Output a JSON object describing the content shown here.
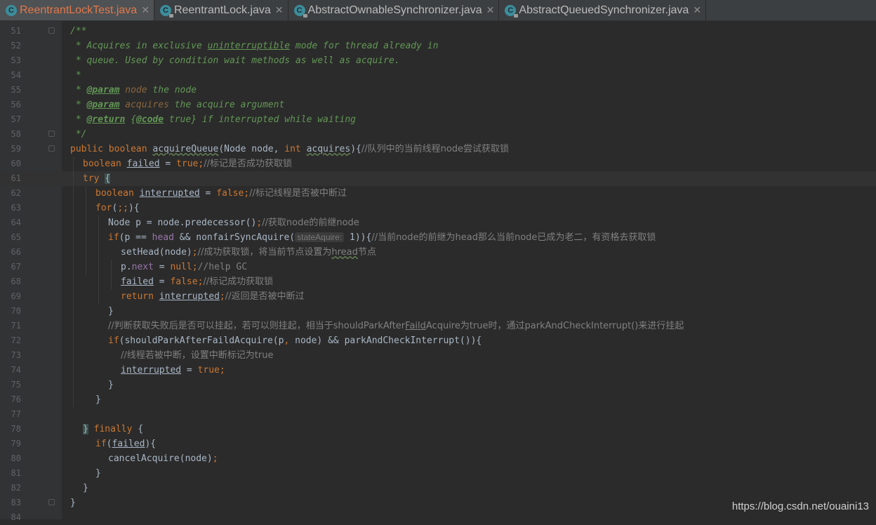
{
  "tabs": [
    {
      "label": "ReentrantLockTest.java",
      "active": true,
      "locked": false
    },
    {
      "label": "ReentrantLock.java",
      "active": false,
      "locked": true
    },
    {
      "label": "AbstractOwnableSynchronizer.java",
      "active": false,
      "locked": true
    },
    {
      "label": "AbstractQueuedSynchronizer.java",
      "active": false,
      "locked": true
    }
  ],
  "lines": [
    {
      "n": "51",
      "fold": true,
      "ind": 0,
      "segs": [
        [
          "cm",
          "/**"
        ]
      ]
    },
    {
      "n": "52",
      "ind": 0,
      "segs": [
        [
          "cm",
          " * Acquires in exclusive "
        ],
        [
          "cm ul",
          "uninterruptible"
        ],
        [
          "cm",
          " mode for thread already in"
        ]
      ]
    },
    {
      "n": "53",
      "ind": 0,
      "segs": [
        [
          "cm",
          " * queue. Used by condition wait methods as well as acquire."
        ]
      ]
    },
    {
      "n": "54",
      "ind": 0,
      "segs": [
        [
          "cm",
          " *"
        ]
      ]
    },
    {
      "n": "55",
      "ind": 0,
      "segs": [
        [
          "cm",
          " * "
        ],
        [
          "tag",
          "@param"
        ],
        [
          "tagv",
          " node"
        ],
        [
          "cm",
          " the node"
        ]
      ]
    },
    {
      "n": "56",
      "ind": 0,
      "segs": [
        [
          "cm",
          " * "
        ],
        [
          "tag",
          "@param"
        ],
        [
          "tagv",
          " acquires"
        ],
        [
          "cm",
          " the acquire argument"
        ]
      ]
    },
    {
      "n": "57",
      "ind": 0,
      "segs": [
        [
          "cm",
          " * "
        ],
        [
          "tag",
          "@return"
        ],
        [
          "cm",
          " {"
        ],
        [
          "tag",
          "@code"
        ],
        [
          "cm",
          " true} if interrupted while waiting"
        ]
      ]
    },
    {
      "n": "58",
      "fold": true,
      "ind": 0,
      "segs": [
        [
          "cm",
          " */"
        ]
      ]
    },
    {
      "n": "59",
      "fold": true,
      "ind": 0,
      "segs": [
        [
          "kw",
          "public boolean "
        ],
        [
          "fn ulw",
          "acquireQueue"
        ],
        [
          "",
          "(Node node, "
        ],
        [
          "kw",
          "int "
        ],
        [
          "ulw",
          "acquires"
        ],
        [
          "",
          "){"
        ],
        [
          "lc cjk",
          "//队列中的当前线程node尝试获取锁"
        ]
      ]
    },
    {
      "n": "60",
      "ind": 1,
      "segs": [
        [
          "kw",
          "boolean "
        ],
        [
          "ul",
          "failed"
        ],
        [
          "",
          " = "
        ],
        [
          "kw",
          "true;"
        ],
        [
          "lc cjk",
          "//标记是否成功获取锁"
        ]
      ]
    },
    {
      "n": "61",
      "ind": 1,
      "current": true,
      "segs": [
        [
          "kw",
          "try "
        ],
        [
          "caret",
          "{"
        ]
      ]
    },
    {
      "n": "62",
      "ind": 2,
      "segs": [
        [
          "kw",
          "boolean "
        ],
        [
          "ul",
          "interrupted"
        ],
        [
          "",
          " = "
        ],
        [
          "kw",
          "false;"
        ],
        [
          "lc cjk",
          "//标记线程是否被中断过"
        ]
      ]
    },
    {
      "n": "63",
      "ind": 2,
      "segs": [
        [
          "kw",
          "for"
        ],
        [
          "",
          "("
        ],
        [
          "kw",
          ";;"
        ],
        [
          "",
          ")"
        ],
        [
          "",
          "{"
        ]
      ]
    },
    {
      "n": "64",
      "ind": 3,
      "segs": [
        [
          "",
          "Node p = node.predecessor()"
        ],
        [
          "kw",
          ";"
        ],
        [
          "lc cjk",
          "//获取node的前继node"
        ]
      ]
    },
    {
      "n": "65",
      "ind": 3,
      "segs": [
        [
          "kw",
          "if"
        ],
        [
          "",
          "(p == "
        ],
        [
          "fld",
          "head"
        ],
        [
          "",
          " && nonfairSyncAquire("
        ],
        [
          "hint",
          "stateAquire:"
        ],
        [
          "",
          " 1)){"
        ],
        [
          "lc cjk",
          "//当前node的前继为head那么当前node已成为老二，有资格去获取锁"
        ]
      ]
    },
    {
      "n": "66",
      "ind": 4,
      "segs": [
        [
          "",
          "setHead(node)"
        ],
        [
          "kw",
          ";"
        ],
        [
          "lc cjk",
          "//成功获取锁，将当前节点设置为"
        ],
        [
          "lc cjk ulw",
          "hread"
        ],
        [
          "lc cjk",
          "节点"
        ]
      ]
    },
    {
      "n": "67",
      "ind": 4,
      "segs": [
        [
          "",
          "p."
        ],
        [
          "fld",
          "next"
        ],
        [
          "",
          " = "
        ],
        [
          "kw",
          "null;"
        ],
        [
          "lc",
          "//help GC"
        ]
      ]
    },
    {
      "n": "68",
      "ind": 4,
      "segs": [
        [
          "ul",
          "failed"
        ],
        [
          "",
          " = "
        ],
        [
          "kw",
          "false;"
        ],
        [
          "lc cjk",
          "//标记成功获取锁"
        ]
      ]
    },
    {
      "n": "69",
      "ind": 4,
      "segs": [
        [
          "kw",
          "return "
        ],
        [
          "ul",
          "interrupted"
        ],
        [
          "kw",
          ";"
        ],
        [
          "lc cjk",
          "//返回是否被中断过"
        ]
      ]
    },
    {
      "n": "70",
      "ind": 3,
      "segs": [
        [
          "",
          "}"
        ]
      ]
    },
    {
      "n": "71",
      "ind": 3,
      "segs": [
        [
          "lc cjk",
          "//判断获取失败后是否可以挂起，若可以则挂起，相当于shouldParkAfter"
        ],
        [
          "lc cjk ul",
          "Faild"
        ],
        [
          "lc cjk",
          "Acquire为true时，通过parkAndCheckInterrupt()来进行挂起"
        ]
      ]
    },
    {
      "n": "72",
      "ind": 3,
      "segs": [
        [
          "kw",
          "if"
        ],
        [
          "",
          "(shouldParkAfterFaildAcquire(p"
        ],
        [
          "kw",
          ", "
        ],
        [
          "",
          "node) && parkAndCheckInterrupt()){"
        ]
      ]
    },
    {
      "n": "73",
      "ind": 4,
      "segs": [
        [
          "lc cjk",
          "//线程若被中断，设置中断标记为true"
        ]
      ]
    },
    {
      "n": "74",
      "ind": 4,
      "segs": [
        [
          "ul",
          "interrupted"
        ],
        [
          "",
          " = "
        ],
        [
          "kw",
          "true;"
        ]
      ]
    },
    {
      "n": "75",
      "ind": 3,
      "segs": [
        [
          "",
          "}"
        ]
      ]
    },
    {
      "n": "76",
      "ind": 2,
      "segs": [
        [
          "",
          "}"
        ]
      ]
    },
    {
      "n": "77",
      "ind": 0,
      "segs": []
    },
    {
      "n": "78",
      "ind": 1,
      "segs": [
        [
          "caret",
          "}"
        ],
        [
          "kw",
          " finally "
        ],
        [
          "",
          "{"
        ]
      ]
    },
    {
      "n": "79",
      "ind": 2,
      "segs": [
        [
          "kw",
          "if"
        ],
        [
          "",
          "("
        ],
        [
          "ul",
          "failed"
        ],
        [
          "",
          ")"
        ],
        [
          "",
          "{"
        ]
      ]
    },
    {
      "n": "80",
      "ind": 3,
      "segs": [
        [
          "",
          "cancelAcquire(node)"
        ],
        [
          "kw",
          ";"
        ]
      ]
    },
    {
      "n": "81",
      "ind": 2,
      "segs": [
        [
          "",
          "}"
        ]
      ]
    },
    {
      "n": "82",
      "ind": 1,
      "segs": [
        [
          "",
          "}"
        ]
      ]
    },
    {
      "n": "83",
      "fold": true,
      "ind": 0,
      "segs": [
        [
          "",
          "}"
        ]
      ]
    },
    {
      "n": "84",
      "ind": 0,
      "segs": []
    }
  ],
  "watermark": "https://blog.csdn.net/ouaini13"
}
